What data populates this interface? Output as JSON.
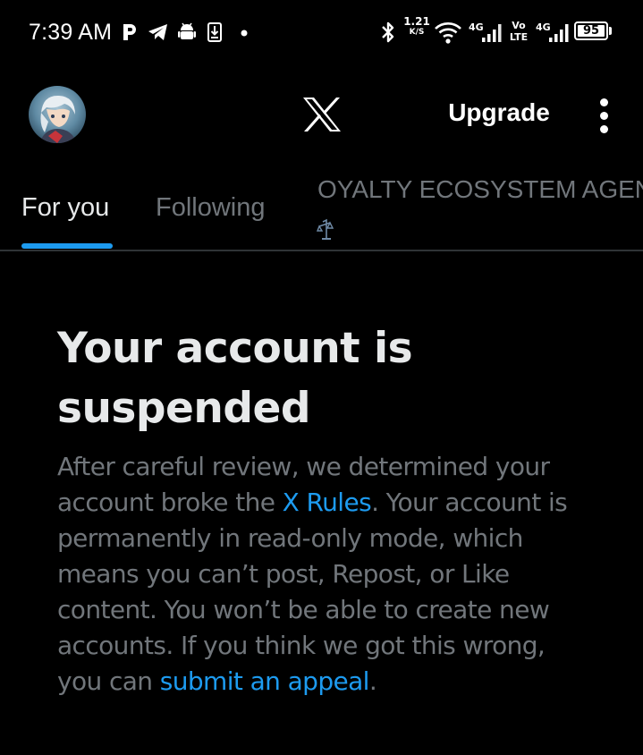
{
  "status_bar": {
    "time": "7:39 AM",
    "notification_icons": [
      "parking-icon",
      "telegram-icon",
      "android-icon",
      "download-icon",
      "dot-icon"
    ],
    "network_speed_value": "1.21",
    "network_speed_unit": "K/S",
    "signal_label_1": "4G",
    "volte_label_top": "Vo",
    "volte_label_bottom": "LTE",
    "signal_label_2": "4G",
    "battery_level": "95"
  },
  "header": {
    "upgrade_label": "Upgrade"
  },
  "tabs": [
    {
      "label": "For you",
      "selected": true
    },
    {
      "label": "Following",
      "selected": false
    },
    {
      "label": "OYALTY ECOSYSTEM AGEN",
      "selected": false
    }
  ],
  "suspension": {
    "title": "Your account is suspended",
    "body_part1": "After careful review, we determined your account broke the ",
    "rules_link": "X Rules",
    "body_part2": ". Your account is permanently in read-only mode, which means you can’t post, Repost, or Like content. You won’t be able to create new accounts. If you think we got this wrong, you can ",
    "appeal_link": "submit an appeal",
    "body_part3": "."
  },
  "colors": {
    "background": "#000000",
    "text_primary": "#e7e9ea",
    "text_secondary": "#71767b",
    "accent": "#1d9bf0",
    "divider": "#2f3336"
  }
}
